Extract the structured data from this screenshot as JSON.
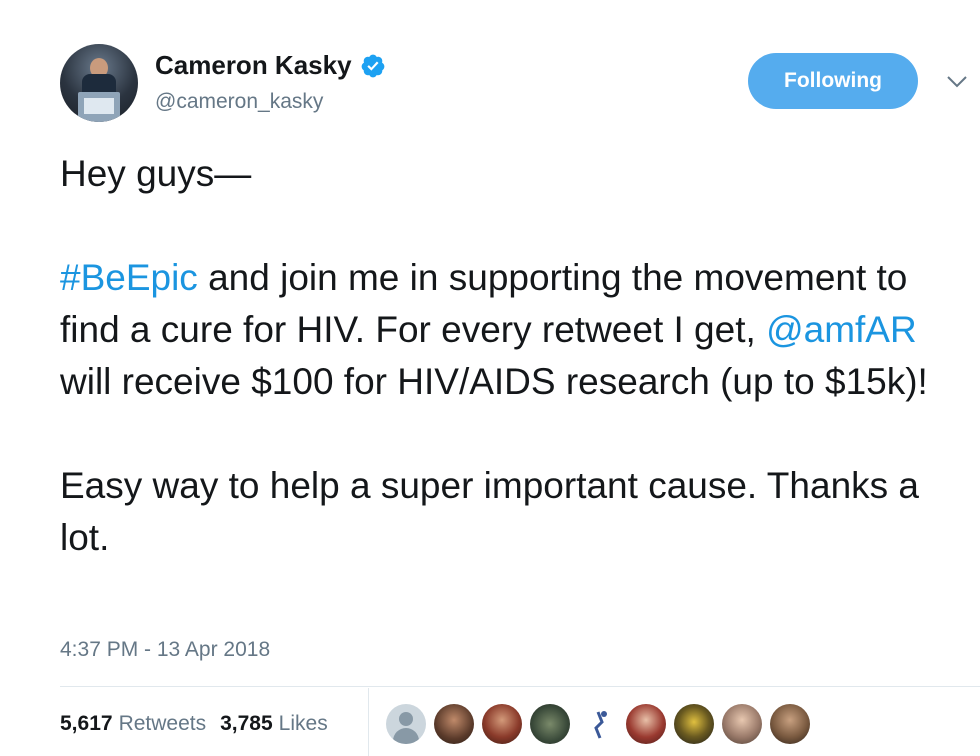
{
  "author": {
    "name": "Cameron Kasky",
    "handle": "@cameron_kasky",
    "verified": true
  },
  "follow_button": {
    "label": "Following"
  },
  "tweet": {
    "line1": "Hey guys—",
    "hashtag": "#BeEpic",
    "p2a": " and join me in supporting the movement to find a cure for HIV. For every retweet I get, ",
    "mention": "@amfAR",
    "p2b": " will receive $100 for HIV/AIDS research (up to $15k)!",
    "p3": "Easy way to help a super important cause. Thanks a lot."
  },
  "timestamp": "4:37 PM - 13 Apr 2018",
  "stats": {
    "retweets_count": "5,617",
    "retweets_label": "Retweets",
    "likes_count": "3,785",
    "likes_label": "Likes"
  },
  "colors": {
    "accent": "#55acee",
    "link": "#1b95e0",
    "secondary_text": "#657786"
  }
}
